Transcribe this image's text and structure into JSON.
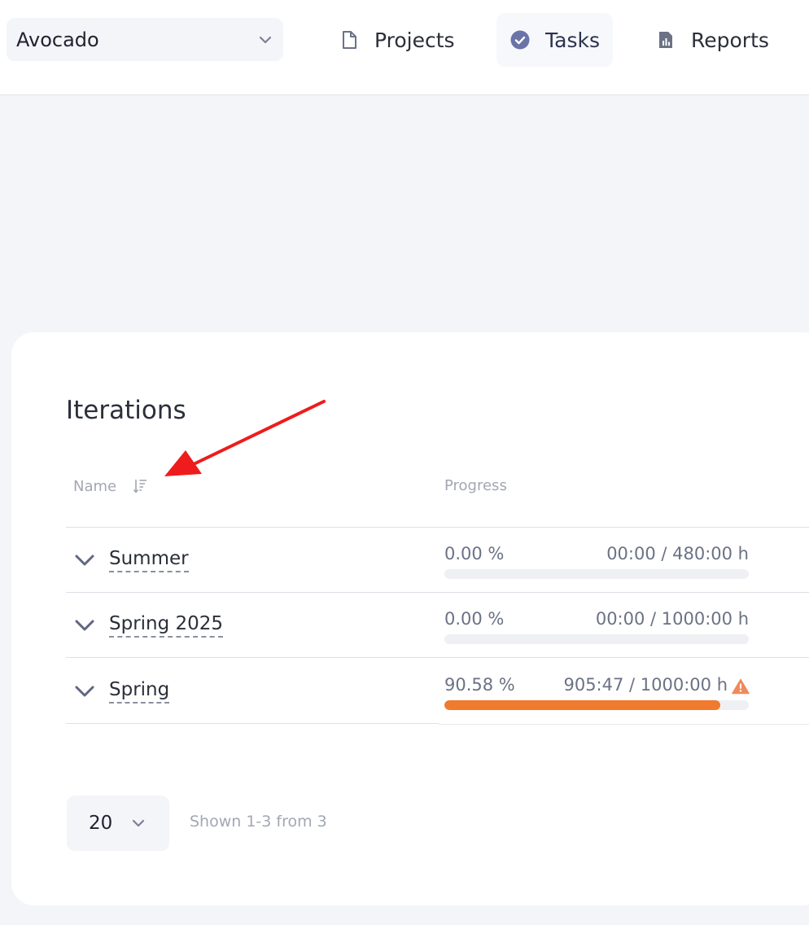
{
  "header": {
    "workspace": "Avocado",
    "nav": [
      {
        "label": "Projects",
        "icon": "file-icon"
      },
      {
        "label": "Tasks",
        "icon": "check-circle-icon"
      },
      {
        "label": "Reports",
        "icon": "report-icon"
      }
    ]
  },
  "iterations": {
    "title": "Iterations",
    "columns": {
      "name": "Name",
      "progress": "Progress"
    },
    "rows": [
      {
        "name": "Summer",
        "percent": "0.00 %",
        "time": "00:00 / 480:00 h",
        "progress": 0.0,
        "warning": false
      },
      {
        "name": "Spring 2025",
        "percent": "0.00 %",
        "time": "00:00 / 1000:00 h",
        "progress": 0.0,
        "warning": false
      },
      {
        "name": "Spring",
        "percent": "90.58 %",
        "time": "905:47 / 1000:00 h",
        "progress": 0.9058,
        "warning": true
      }
    ]
  },
  "pagination": {
    "page_size": "20",
    "shown": "Shown 1-3 from 3"
  },
  "colors": {
    "accent": "#6a74a8",
    "progress_fill": "#f07a2e",
    "warning": "#f08a5b",
    "annotation_arrow": "#ee1c1c"
  }
}
